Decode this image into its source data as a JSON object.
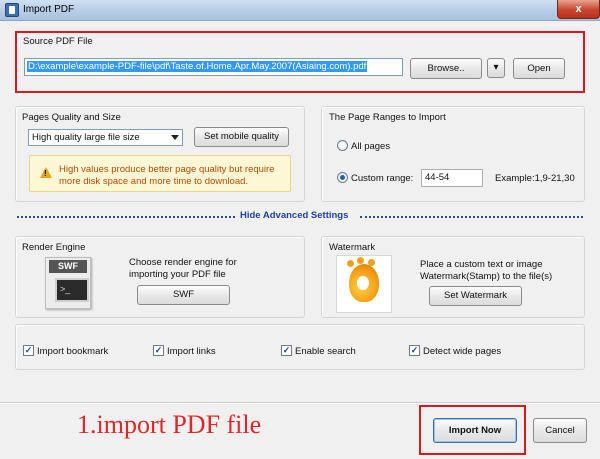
{
  "window": {
    "title": "Import PDF",
    "close_glyph": "x"
  },
  "source": {
    "group_label": "Source PDF File",
    "path_value": "D:\\example\\example-PDF-file\\pdf\\Taste.of.Home.Apr.May.2007(Asiaing.com).pdf",
    "browse_label": "Browse..",
    "dropdown_glyph": "▾",
    "open_label": "Open"
  },
  "quality": {
    "group_label": "Pages Quality and Size",
    "selected": "High quality large file size",
    "mobile_button": "Set mobile quality",
    "warning_line1": "High values produce better page quality but require",
    "warning_line2": "more disk space and more time to download.",
    "warning_icon": "warning-icon"
  },
  "ranges": {
    "group_label": "The Page Ranges to Import",
    "all_pages": "All pages",
    "custom_range": "Custom range:",
    "custom_value": "44-54",
    "example": "Example:1,9-21,30",
    "selected_option": "custom"
  },
  "advanced": {
    "toggle_label": "Hide Advanced Settings"
  },
  "render": {
    "group_label": "Render Engine",
    "icon_tag": "SWF",
    "terminal_prompt": ">_",
    "desc_line1": "Choose render engine for",
    "desc_line2": "importing your PDF file",
    "button": "SWF"
  },
  "watermark": {
    "group_label": "Watermark",
    "desc_line1": "Place a custom text or image",
    "desc_line2": "Watermark(Stamp) to the file(s)",
    "button": "Set Watermark"
  },
  "options": [
    {
      "label": "Import bookmark",
      "checked": true
    },
    {
      "label": "Import links",
      "checked": true
    },
    {
      "label": "Enable search",
      "checked": true
    },
    {
      "label": "Detect wide pages",
      "checked": true
    }
  ],
  "check_glyph": "✓",
  "footer": {
    "annotation": "1.import PDF file",
    "import_button": "Import Now",
    "cancel_button": "Cancel"
  },
  "colors": {
    "highlight_red": "#d8191d",
    "link_blue": "#1f3fa6",
    "selection_blue": "#3399ff"
  }
}
